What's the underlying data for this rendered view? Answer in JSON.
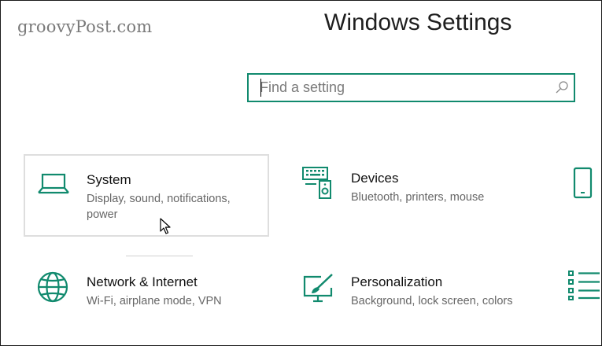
{
  "watermark": "groovyPost.com",
  "header": {
    "title": "Windows Settings"
  },
  "search": {
    "placeholder": "Find a setting",
    "value": ""
  },
  "tiles": [
    {
      "title": "System",
      "description": "Display, sound, notifications, power",
      "icon": "laptop-icon"
    },
    {
      "title": "Devices",
      "description": "Bluetooth, printers, mouse",
      "icon": "devices-icon"
    },
    {
      "title": "",
      "description": "",
      "icon": "phone-icon"
    },
    {
      "title": "Network & Internet",
      "description": "Wi-Fi, airplane mode, VPN",
      "icon": "globe-icon"
    },
    {
      "title": "Personalization",
      "description": "Background, lock screen, colors",
      "icon": "paint-icon"
    },
    {
      "title": "",
      "description": "",
      "icon": "apps-list-icon"
    }
  ],
  "colors": {
    "accent": "#118a6e",
    "hover_border": "#dedede",
    "description": "#666666"
  }
}
